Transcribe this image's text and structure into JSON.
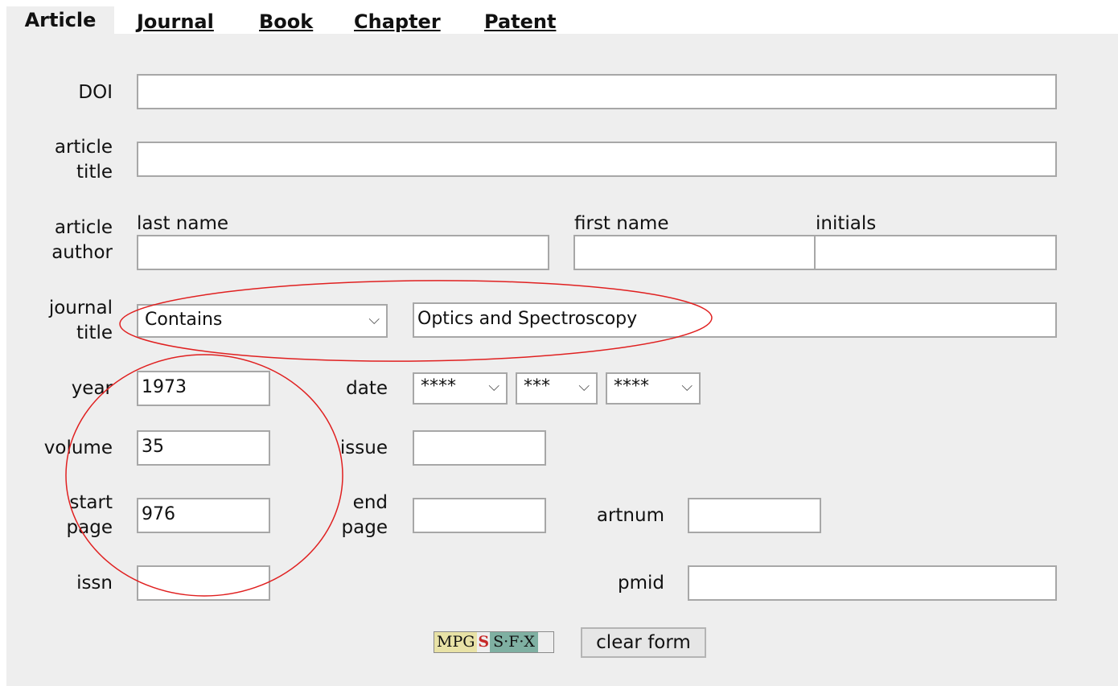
{
  "tabs": [
    {
      "label": "Article",
      "active": true
    },
    {
      "label": "Journal",
      "active": false
    },
    {
      "label": "Book",
      "active": false
    },
    {
      "label": "Chapter",
      "active": false
    },
    {
      "label": "Patent",
      "active": false
    }
  ],
  "form": {
    "doi": {
      "label": "DOI",
      "value": ""
    },
    "article_title": {
      "label_line1": "article",
      "label_line2": "title",
      "value": ""
    },
    "article_author": {
      "label_line1": "article",
      "label_line2": "author",
      "last_name_label": "last name",
      "last_name": "",
      "first_name_label": "first name",
      "first_name": "",
      "initials_label": "initials",
      "initials": ""
    },
    "journal_title": {
      "label_line1": "journal",
      "label_line2": "title",
      "match_mode": "Contains",
      "value": "Optics and Spectroscopy"
    },
    "year": {
      "label": "year",
      "value": "1973"
    },
    "date": {
      "label": "date",
      "year_select": "****",
      "month_select": "***",
      "day_select": "****"
    },
    "volume": {
      "label": "volume",
      "value": "35"
    },
    "issue": {
      "label": "issue",
      "value": ""
    },
    "start_page": {
      "label_line1": "start",
      "label_line2": "page",
      "value": "976"
    },
    "end_page": {
      "label_line1": "end",
      "label_line2": "page",
      "value": ""
    },
    "artnum": {
      "label": "artnum",
      "value": ""
    },
    "issn": {
      "label": "issn",
      "value": ""
    },
    "pmid": {
      "label": "pmid",
      "value": ""
    }
  },
  "buttons": {
    "sfx_mpg": "MPG",
    "sfx_logo": "S",
    "sfx_text": "S·F·X",
    "clear_form": "clear form"
  },
  "colors": {
    "panel_bg": "#eeeeee",
    "annotation_red": "#e02020"
  },
  "chevron": "⌵"
}
